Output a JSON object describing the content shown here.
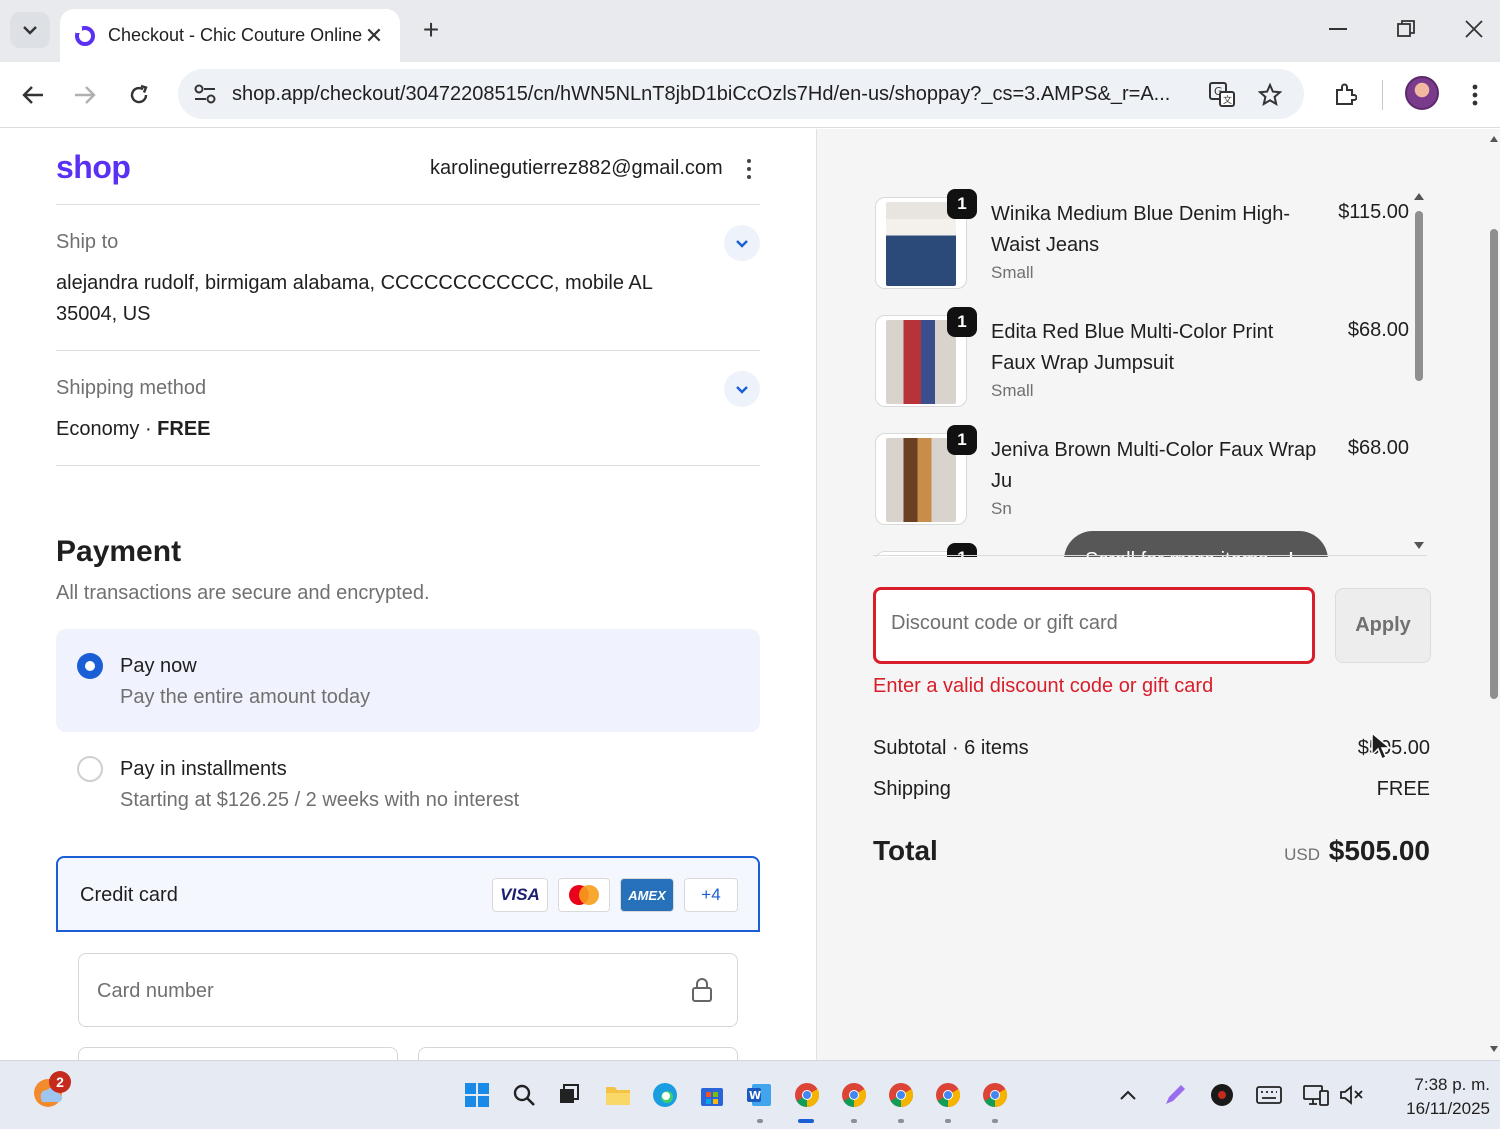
{
  "browser": {
    "tab_title": "Checkout - Chic Couture Online",
    "url": "shop.app/checkout/30472208515/cn/hWN5NLnT8jbD1biCcOzls7Hd/en-us/shoppay?_cs=3.AMPS&_r=A..."
  },
  "header": {
    "logo": "shop",
    "email": "karolinegutierrez882@gmail.com"
  },
  "ship_to": {
    "label": "Ship to",
    "address_line1": "alejandra rudolf, birmigam alabama, CCCCCCCCCCCC, mobile AL",
    "address_line2": "35004, US"
  },
  "shipping_method": {
    "label": "Shipping method",
    "name": "Economy",
    "separator": "·",
    "price": "FREE"
  },
  "payment": {
    "title": "Payment",
    "subtitle": "All transactions are secure and encrypted.",
    "option_now_title": "Pay now",
    "option_now_sub": "Pay the entire amount today",
    "option_inst_title": "Pay in installments",
    "option_inst_sub": "Starting at $126.25 / 2 weeks with no interest",
    "credit_card_label": "Credit card",
    "card_brands": [
      "VISA",
      "AMEX",
      "+4"
    ],
    "card_number_placeholder": "Card number",
    "selected_option": "Pay now"
  },
  "cart": {
    "items": [
      {
        "qty": "1",
        "name": "Winika Medium Blue Denim High-Waist Jeans",
        "variant": "Small",
        "price": "$115.00"
      },
      {
        "qty": "1",
        "name": "Edita Red Blue Multi-Color Print Faux Wrap Jumpsuit",
        "variant": "Small",
        "price": "$68.00"
      },
      {
        "qty": "1",
        "name": "Jeniva Brown Multi-Color Faux Wrap Ju",
        "variant": "Sn",
        "price": "$68.00"
      },
      {
        "qty": "1"
      }
    ],
    "scroll_hint": "Scroll for more items"
  },
  "discount": {
    "placeholder": "Discount code or gift card",
    "apply_label": "Apply",
    "error": "Enter a valid discount code or gift card"
  },
  "summary": {
    "subtotal_label": "Subtotal · 6 items",
    "subtotal_value": "$505.00",
    "shipping_label": "Shipping",
    "shipping_value": "FREE",
    "total_label": "Total",
    "total_currency": "USD",
    "total_value": "$505.00"
  },
  "taskbar": {
    "notification_badge": "2",
    "time": "7:38 p. m.",
    "date": "16/11/2025"
  },
  "colors": {
    "shop_brand": "#5a31f4",
    "accent_blue": "#1a5fd6",
    "error_red": "#d91e2b"
  },
  "icons": [
    "tab-search-icon",
    "close-icon",
    "plus-icon",
    "minimize-icon",
    "restore-icon",
    "back-icon",
    "forward-icon",
    "reload-icon",
    "site-info-icon",
    "translate-icon",
    "star-icon",
    "extensions-icon",
    "more-icon",
    "chevron-down-icon",
    "lock-icon",
    "arrow-down-icon"
  ]
}
